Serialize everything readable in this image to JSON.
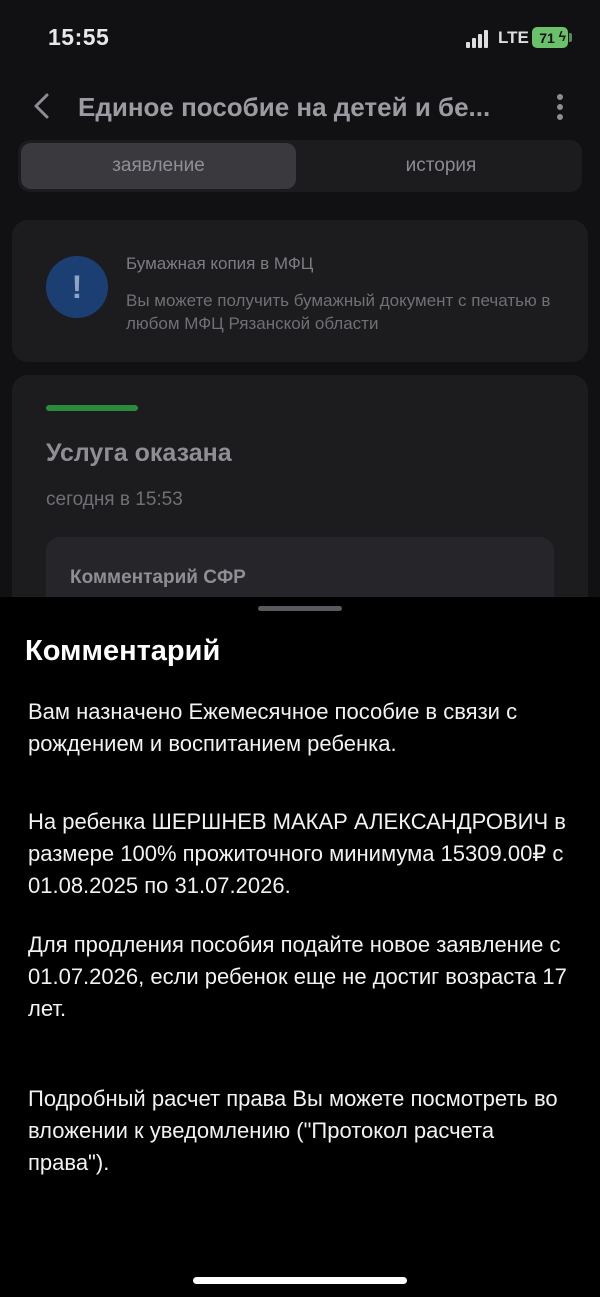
{
  "status_bar": {
    "time": "15:55",
    "network": "LTE",
    "battery": "71"
  },
  "nav": {
    "title": "Единое пособие на детей и бе..."
  },
  "tabs": [
    {
      "label": "заявление",
      "active": true
    },
    {
      "label": "история",
      "active": false
    }
  ],
  "info_card": {
    "icon": "exclamation-icon",
    "title": "Бумажная копия в МФЦ",
    "text": "Вы можете получить бумажный документ с печатью в любом МФЦ Рязанской области"
  },
  "status_card": {
    "status": "Услуга оказана",
    "time": "сегодня в 15:53",
    "comment_label": "Комментарий СФР",
    "status_color": "#2c8a3f"
  },
  "sheet": {
    "title": "Комментарий",
    "paragraphs": [
      "Вам назначено Ежемесячное пособие в связи с рождением и воспитанием ребенка.",
      "На ребенка ШЕРШНЕВ МАКАР АЛЕКСАНДРОВИЧ в размере 100% прожиточного минимума 15309.00₽ с 01.08.2025 по 31.07.2026.",
      "Для продления пособия подайте новое заявление с 01.07.2026, если ребенок еще не достиг возраста 17 лет.",
      "Подробный расчет права Вы можете посмотреть во вложении к уведомлению (\"Протокол расчета права\")."
    ]
  }
}
